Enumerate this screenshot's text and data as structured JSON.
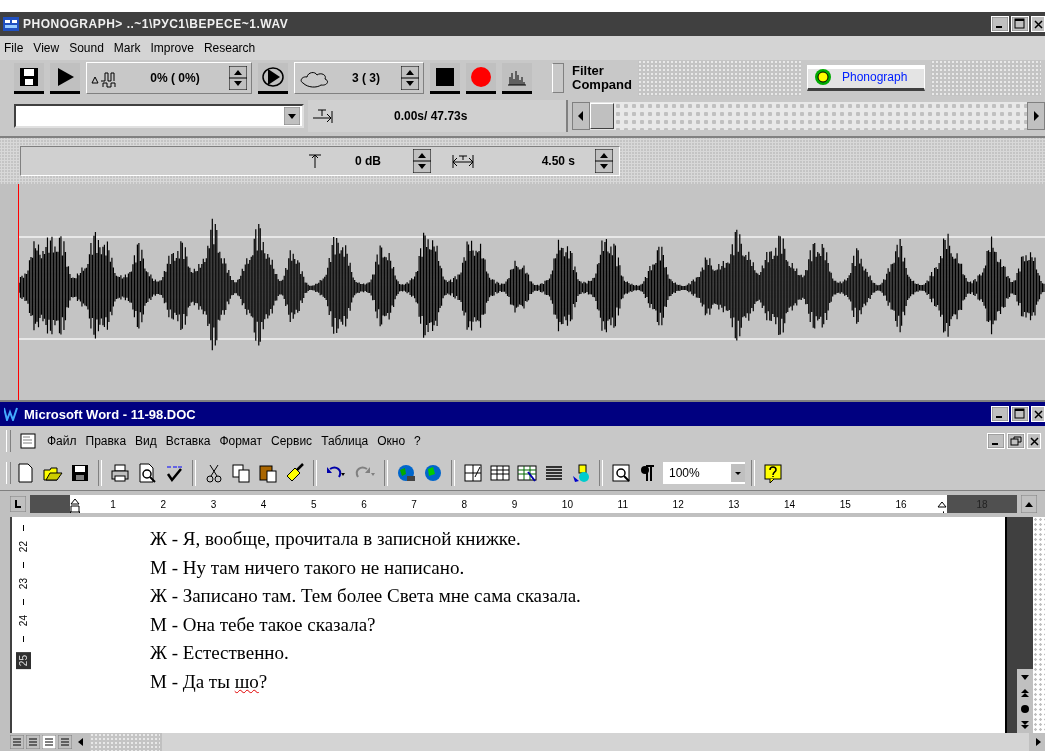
{
  "phonograph": {
    "title": "PHONOGRAPH> ..~1\\РУС1\\ВЕРЕСЕ~1.WAV",
    "menu": [
      "File",
      "View",
      "Sound",
      "Mark",
      "Improve",
      "Research"
    ],
    "toolbar": {
      "percent": "0% ( 0%)",
      "count": "3 ( 3)",
      "filter": "Filter",
      "compand": "Compand",
      "brand_button": "Phonograph"
    },
    "position": {
      "time": "0.00s/ 47.73s"
    },
    "gain": {
      "level_text": "0 dB",
      "duration": "4.50 s"
    }
  },
  "word": {
    "title": "Microsoft Word - 11-98.DOC",
    "menu": [
      "Файл",
      "Правка",
      "Вид",
      "Вставка",
      "Формат",
      "Сервис",
      "Таблица",
      "Окно",
      "?"
    ],
    "zoom": "100%",
    "ruler_labels": [
      "1",
      "2",
      "3",
      "4",
      "5",
      "6",
      "7",
      "8",
      "9",
      "10",
      "11",
      "12",
      "13",
      "14",
      "15",
      "16"
    ],
    "ruler_end_label": "18",
    "vertical_ruler": [
      {
        "label": "22",
        "selected": false
      },
      {
        "label": "23",
        "selected": false
      },
      {
        "label": "24",
        "selected": false
      },
      {
        "label": "25",
        "selected": true
      }
    ],
    "lines": [
      {
        "parts": [
          {
            "text": "Ж - Я, вообще, прочитала в записной книжке.",
            "misspelled": false
          }
        ]
      },
      {
        "parts": [
          {
            "text": "М - Ну там ничего такого не написано.",
            "misspelled": false
          }
        ]
      },
      {
        "parts": [
          {
            "text": "Ж - Записано там. Тем более Света мне сама сказала.",
            "misspelled": false
          }
        ]
      },
      {
        "parts": [
          {
            "text": "М - Она тебе такое сказала?",
            "misspelled": false
          }
        ]
      },
      {
        "parts": [
          {
            "text": "Ж - Естественно.",
            "misspelled": false
          }
        ]
      },
      {
        "parts": [
          {
            "text": "М - Да ты ",
            "misspelled": false
          },
          {
            "text": "шо",
            "misspelled": true
          },
          {
            "text": "?",
            "misspelled": false
          }
        ]
      }
    ]
  }
}
